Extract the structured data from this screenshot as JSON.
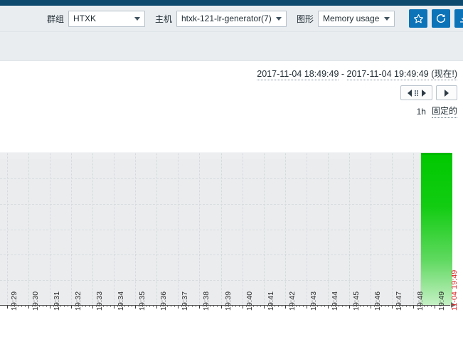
{
  "toolbar": {
    "group_label": "群组",
    "group_value": "HTXK",
    "host_label": "主机",
    "host_value": "htxk-121-lr-generator(7)",
    "graph_label": "图形",
    "graph_value": "Memory usage",
    "favorite_icon": "star-icon",
    "refresh_icon": "refresh-icon",
    "third_icon": "export-icon",
    "accent_color": "#0c73b8",
    "header_color": "#0d4a6e"
  },
  "range": {
    "from": "2017-11-04 18:49:49",
    "separator": " - ",
    "to": "2017-11-04 19:49:49",
    "now_label": "(现在!)",
    "full_text": "2017-11-04 18:49:49 - 2017-11-04 19:49:49 (现在!)",
    "zoom_label": "1h",
    "fixed_label": "固定的",
    "nav_back_icon": "triangle-left-icon",
    "nav_grip_icon": "drag-handle-icon",
    "nav_forward_icon": "triangle-right-icon",
    "nav_next_icon": "triangle-right-icon"
  },
  "chart_data": {
    "type": "bar",
    "title": "Memory usage",
    "xlabel": "",
    "ylabel": "",
    "grid": true,
    "legend": "none",
    "x_tick_labels": [
      "19:29",
      "19:30",
      "19:31",
      "19:32",
      "19:33",
      "19:34",
      "19:35",
      "19:36",
      "19:37",
      "19:38",
      "19:39",
      "19:40",
      "19:41",
      "19:42",
      "19:43",
      "19:44",
      "19:45",
      "19:46",
      "19:47",
      "19:48",
      "19:49"
    ],
    "now_tick_label": "11-04 19:49",
    "now_tick_color": "#dd2020",
    "categories": [
      "19:29",
      "19:30",
      "19:31",
      "19:32",
      "19:33",
      "19:34",
      "19:35",
      "19:36",
      "19:37",
      "19:38",
      "19:39",
      "19:40",
      "19:41",
      "19:42",
      "19:43",
      "19:44",
      "19:45",
      "19:46",
      "19:47",
      "19:48",
      "19:49"
    ],
    "values": [
      0,
      0,
      0,
      0,
      0,
      0,
      0,
      0,
      0,
      0,
      0,
      0,
      0,
      0,
      0,
      0,
      0,
      0,
      0,
      0,
      100
    ],
    "series": [
      {
        "name": "Memory usage",
        "color": "#00c800",
        "values": [
          0,
          0,
          0,
          0,
          0,
          0,
          0,
          0,
          0,
          0,
          0,
          0,
          0,
          0,
          0,
          0,
          0,
          0,
          0,
          0,
          100
        ]
      }
    ],
    "ylim": [
      0,
      100
    ],
    "bar_color_top": "#00c800",
    "bar_color_bottom": "#c6f0c6",
    "plot_background": "#eaecee",
    "gridline_color": "#d9dcdf",
    "horizontal_gridlines": 6,
    "vertical_gridlines": 21
  }
}
